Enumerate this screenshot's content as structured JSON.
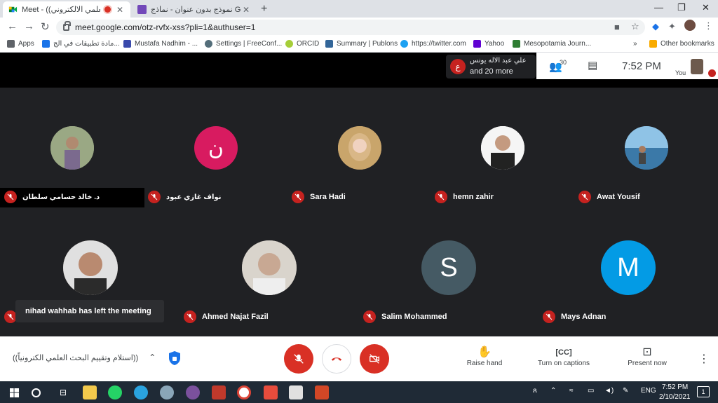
{
  "browser": {
    "tabs": [
      {
        "title": "Meet - ((البحث العلمي الالكتروني",
        "active": true
      },
      {
        "title": "نموذج بدون عنوان - نماذج Google",
        "active": false
      }
    ],
    "url": "meet.google.com/otz-rvfx-xss?pli=1&authuser=1",
    "bookmarks": [
      {
        "label": "Apps",
        "color": "#5f6368"
      },
      {
        "label": "مادة تطبيقات في الج...",
        "color": "#1a73e8"
      },
      {
        "label": "Mustafa Nadhim - ...",
        "color": "#3949ab"
      },
      {
        "label": "Settings | FreeConf...",
        "color": "#546e7a"
      },
      {
        "label": "ORCID",
        "color": "#a6ce39"
      },
      {
        "label": "Summary | Publons",
        "color": "#336699"
      },
      {
        "label": "https://twitter.com",
        "color": "#1da1f2"
      },
      {
        "label": "Yahoo",
        "color": "#6001d2"
      },
      {
        "label": "Mesopotamia Journ...",
        "color": "#2e7d32"
      }
    ],
    "bookmarks_more": "»",
    "other_bookmarks": "Other bookmarks"
  },
  "meet": {
    "presenter_initial": "ع",
    "presenter_name": "علي عبد الاله يونس",
    "presenter_more": "and 20 more",
    "participant_count": "30",
    "time": "7:52 PM",
    "self_label": "You",
    "participants": [
      {
        "name": "د. خالد حسامي سلطان",
        "avatar": "photo",
        "color": "#8d9c7a"
      },
      {
        "name": "نواف غازي عبود",
        "avatar": "letter",
        "letter": "ن",
        "color": "#d81b60"
      },
      {
        "name": "Sara Hadi",
        "avatar": "photo",
        "color": "#c9a56b"
      },
      {
        "name": "hemn zahir",
        "avatar": "photo",
        "color": "#3a3a3a"
      },
      {
        "name": "Awat Yousif",
        "avatar": "photo",
        "color": "#4f8fc0"
      },
      {
        "name": "",
        "avatar": "photo",
        "color": "#7a6a5a"
      },
      {
        "name": "Ahmed Najat Fazil",
        "avatar": "photo",
        "color": "#9e9288"
      },
      {
        "name": "Salim Mohammed",
        "avatar": "letter",
        "letter": "S",
        "color": "#455a64"
      },
      {
        "name": "Mays Adnan",
        "avatar": "letter",
        "letter": "M",
        "color": "#039be5"
      }
    ],
    "toast": "nihad wahhab has left the meeting",
    "meeting_name": "((استلام وتقييم البحث العلمي الكترونياً))",
    "raise_hand": "Raise hand",
    "captions": "Turn on captions",
    "present": "Present now"
  },
  "taskbar": {
    "lang": "ENG",
    "time": "7:52 PM",
    "date": "2/10/2021",
    "notif": "1"
  }
}
